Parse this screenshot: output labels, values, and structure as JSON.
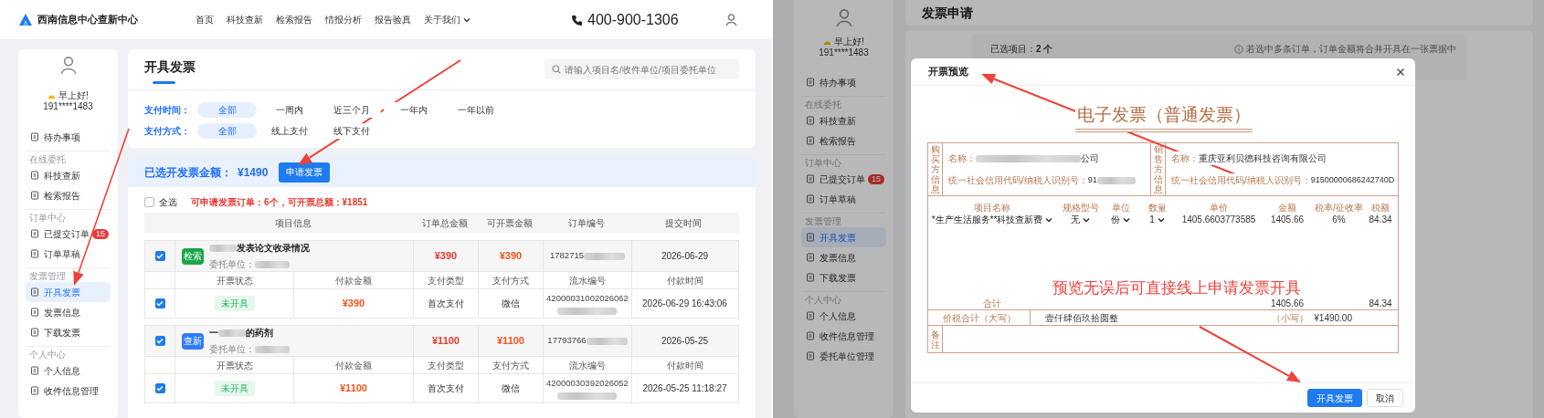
{
  "left": {
    "header": {
      "logo": "西南信息中心查新中心",
      "nav": [
        {
          "label": "首页",
          "dropdown": false
        },
        {
          "label": "科技查新",
          "dropdown": false
        },
        {
          "label": "检索报告",
          "dropdown": false
        },
        {
          "label": "情报分析",
          "dropdown": false
        },
        {
          "label": "报告验真",
          "dropdown": false
        },
        {
          "label": "关于我们",
          "dropdown": true
        }
      ],
      "phone": "400-900-1306"
    },
    "sidebar": {
      "greeting": "早上好!",
      "phone": "191****1483",
      "sections": [
        {
          "items": [
            {
              "label": "待办事项",
              "selected": false
            }
          ]
        },
        {
          "title": "在线委托",
          "items": [
            {
              "label": "科技查新",
              "selected": false
            },
            {
              "label": "检索报告",
              "selected": false
            }
          ]
        },
        {
          "title": "订单中心",
          "items": [
            {
              "label": "已提交订单",
              "selected": false,
              "badge": "15"
            },
            {
              "label": "订单草稿",
              "selected": false
            }
          ]
        },
        {
          "title": "发票管理",
          "items": [
            {
              "label": "开具发票",
              "selected": true
            },
            {
              "label": "发票信息",
              "selected": false
            },
            {
              "label": "下载发票",
              "selected": false
            }
          ]
        },
        {
          "title": "个人中心",
          "items": [
            {
              "label": "个人信息",
              "selected": false
            },
            {
              "label": "收件信息管理",
              "selected": false
            }
          ]
        }
      ]
    },
    "page_title": "开具发票",
    "search": {
      "placeholder": "请输入项目名/收件单位/项目委托单位"
    },
    "filters": [
      {
        "label": "支付时间：",
        "options": [
          {
            "label": "全部",
            "selected": true
          },
          {
            "label": "一周内",
            "selected": false
          },
          {
            "label": "近三个月",
            "selected": false
          },
          {
            "label": "一年内",
            "selected": false
          },
          {
            "label": "一年以前",
            "selected": false
          }
        ]
      },
      {
        "label": "支付方式：",
        "options": [
          {
            "label": "全部",
            "selected": true
          },
          {
            "label": "线上支付",
            "selected": false
          },
          {
            "label": "线下支付",
            "selected": false
          }
        ]
      }
    ],
    "summary": {
      "label": "已选开发票金额：",
      "amount": "¥1490",
      "button": "申请发票"
    },
    "select_all": {
      "label": "全选",
      "checked": false
    },
    "notice": "可申请发票订单：6个，可开票总额：¥1851",
    "table": {
      "columns": [
        "项目信息",
        "订单总金额",
        "可开票金额",
        "订单编号",
        "提交时间"
      ],
      "orders": [
        {
          "checked": true,
          "type_badge": "检索",
          "color": "#1aa64a",
          "title": [
            {
              "kind": "blur"
            },
            {
              "kind": "text",
              "text": "发表论文收录情况"
            }
          ],
          "client": [
            {
              "kind": "text",
              "text": "委托单位："
            },
            {
              "kind": "blur"
            }
          ],
          "total": "¥390",
          "invoiceable": "¥390",
          "order_no": [
            {
              "kind": "text",
              "text": "1782715"
            },
            {
              "kind": "blur"
            }
          ],
          "submitted": "2026-06-29",
          "sub_columns": [
            "开票状态",
            "付款金额",
            "支付类型",
            "支付方式",
            "流水编号",
            "付款时间"
          ],
          "payment": {
            "checked": true,
            "status": "未开具",
            "amount": "¥390",
            "pay_type": "首次支付",
            "method": "微信",
            "serial": [
              {
                "kind": "text",
                "text": "42000031002026062"
              },
              {
                "kind": "blur"
              }
            ],
            "paid_at": "2026-06-29 16:43:06"
          }
        },
        {
          "checked": true,
          "type_badge": "查新",
          "color": "#2f7cf6",
          "title": [
            {
              "kind": "text",
              "text": "一"
            },
            {
              "kind": "blur"
            },
            {
              "kind": "text",
              "text": "的药剂"
            }
          ],
          "client": [
            {
              "kind": "text",
              "text": "委托单位："
            },
            {
              "kind": "blur"
            }
          ],
          "total": "¥1100",
          "invoiceable": "¥1100",
          "order_no": [
            {
              "kind": "text",
              "text": "17793766"
            },
            {
              "kind": "blur"
            }
          ],
          "submitted": "2026-05-25",
          "sub_columns": [
            "开票状态",
            "付款金额",
            "支付类型",
            "支付方式",
            "流水编号",
            "付款时间"
          ],
          "payment": {
            "checked": true,
            "status": "未开具",
            "amount": "¥1100",
            "pay_type": "首次支付",
            "method": "微信",
            "serial": [
              {
                "kind": "text",
                "text": "42000030392026052"
              },
              {
                "kind": "blur"
              }
            ],
            "paid_at": "2026-05-25 11:18:27"
          }
        }
      ]
    }
  },
  "right": {
    "sidebar": {
      "greeting": "早上好!",
      "phone": "191****1483",
      "sections": [
        {
          "items": [
            {
              "label": "待办事项",
              "selected": false
            }
          ]
        },
        {
          "title": "在线委托",
          "items": [
            {
              "label": "科技查新",
              "selected": false
            },
            {
              "label": "检索报告",
              "selected": false
            }
          ]
        },
        {
          "title": "订单中心",
          "items": [
            {
              "label": "已提交订单",
              "selected": false,
              "badge": "15"
            },
            {
              "label": "订单草稿",
              "selected": false
            }
          ]
        },
        {
          "title": "发票管理",
          "items": [
            {
              "label": "开具发票",
              "selected": true
            },
            {
              "label": "发票信息",
              "selected": false
            },
            {
              "label": "下载发票",
              "selected": false
            }
          ]
        },
        {
          "title": "个人中心",
          "items": [
            {
              "label": "个人信息",
              "selected": false
            },
            {
              "label": "收件信息管理",
              "selected": false
            },
            {
              "label": "委托单位管理",
              "selected": false
            }
          ]
        }
      ]
    },
    "page_title": "发票申请",
    "selection": "已选项目：**2 个**",
    "hint": "若选中多条订单，订单金额将合并开具在一张票据中",
    "modal": {
      "title": "开票预览",
      "invoice": {
        "title": "电子发票（普通发票）",
        "parties": [
          {
            "side_label": "购买方信息",
            "name_label": "名称：",
            "name": [
              {
                "kind": "blur"
              },
              {
                "kind": "text",
                "text": "公司"
              }
            ],
            "tax_label": "统一社会信用代码/纳税人识别号：",
            "tax_id": [
              {
                "kind": "text",
                "text": "91"
              },
              {
                "kind": "blur"
              }
            ]
          },
          {
            "side_label": "销售方信息",
            "name_label": "名称：",
            "name": [
              {
                "kind": "text",
                "text": "重庆亚利贝德科技咨询有限公司"
              }
            ],
            "tax_label": "统一社会信用代码/纳税人识别号：",
            "tax_id": [
              {
                "kind": "text",
                "text": "91500000686242740D"
              }
            ]
          }
        ],
        "columns": [
          "项目名称",
          "规格型号",
          "单位",
          "数量",
          "单价",
          "金额",
          "税率/征收率",
          "税额"
        ],
        "items": [
          {
            "cells": [
              {
                "kind": "select",
                "text": "*生产生活服务**科技查新费"
              },
              {
                "kind": "select",
                "text": "无"
              },
              {
                "kind": "select",
                "text": "份"
              },
              {
                "kind": "select",
                "text": "1"
              },
              {
                "kind": "text",
                "text": "1405.6603773585"
              },
              {
                "kind": "text",
                "text": "1405.66"
              },
              {
                "kind": "text",
                "text": "6%"
              },
              {
                "kind": "text",
                "text": "84.34"
              }
            ]
          }
        ],
        "total": {
          "label": "合计",
          "amount": "1405.66",
          "tax": "84.34"
        },
        "grand": {
          "label": "价税合计（大写）",
          "words": "壹仟肆佰玖拾圆整",
          "small_label": "（小写）",
          "small": "¥1490.00"
        },
        "remark_label": "备注"
      },
      "buttons": [
        {
          "label": "开具发票",
          "kind": "primary"
        },
        {
          "label": "取消",
          "kind": "secondary"
        }
      ]
    },
    "annotation": "预览无误后可直接线上申请发票开具"
  }
}
